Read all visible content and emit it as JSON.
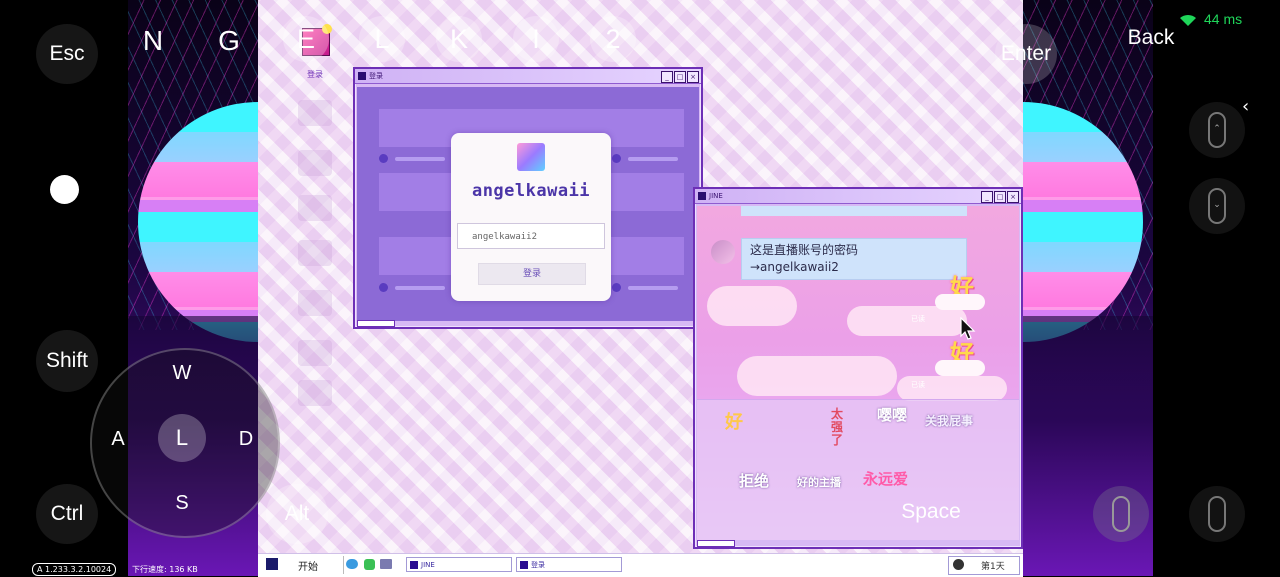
{
  "overlay": {
    "keys": {
      "esc": "Esc",
      "shift": "Shift",
      "ctrl": "Ctrl",
      "alt": "Alt",
      "enter": "Enter",
      "back": "Back",
      "space": "Space"
    },
    "letter_keys": [
      "N",
      "G",
      "E",
      "L",
      "K",
      "I",
      "2"
    ],
    "joystick": {
      "up": "W",
      "left": "A",
      "center": "L",
      "right": "D",
      "down": "S"
    },
    "ping": "44 ms",
    "version": "A 1.233.3.2.10024",
    "download_speed": "下行速度: 136 KB"
  },
  "desktop": {
    "icon_label": "登录"
  },
  "login_window": {
    "title": "登录",
    "username": "angelkawaii",
    "password_value": "angelkawaii2",
    "login_button": "登录"
  },
  "chat_window": {
    "title": "JINE",
    "message_line1": "这是直播账号的密码",
    "message_line2": "→angelkawaii2",
    "sticker_text": "好",
    "read_label": "已读",
    "sticker_panel": [
      "好",
      "太强了",
      "嘤嘤",
      "关我屁事",
      "拒绝",
      "好的主播",
      "永远爱"
    ]
  },
  "taskbar": {
    "start_label": "开始",
    "items": [
      "JINE",
      "登录"
    ],
    "day_label": "第1天"
  },
  "colors": {
    "accent": "#6d2fb6",
    "wallpaper": "#f2dcf3",
    "bubble": "#cfe3fb"
  }
}
